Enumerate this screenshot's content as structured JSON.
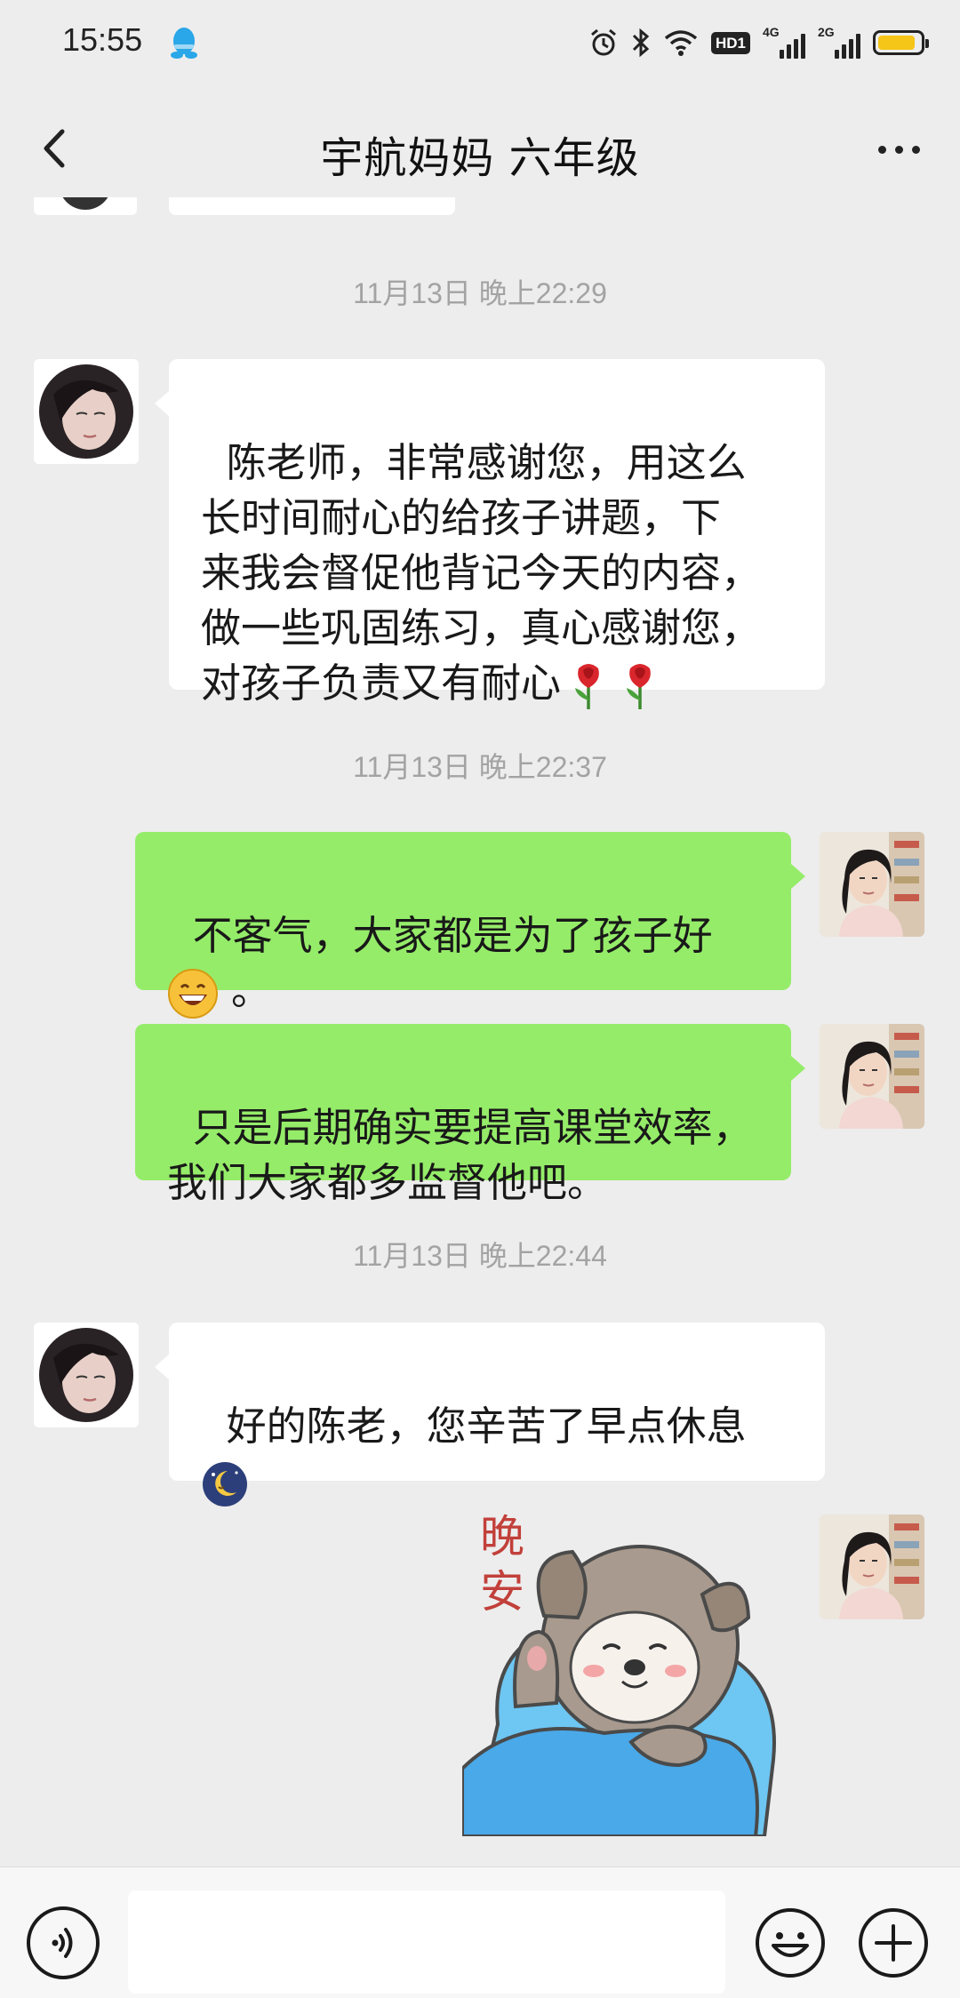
{
  "status_bar": {
    "time": "15:55",
    "hd_badge": "HD1",
    "network_1": "4G",
    "network_2": "2G",
    "battery_level": 0.9
  },
  "header": {
    "title": "宇航妈妈  六年级"
  },
  "colors": {
    "background": "#ededed",
    "bubble_incoming": "#ffffff",
    "bubble_outgoing": "#95ec69",
    "timestamp": "#a3a3a3",
    "battery_fill": "#f5c518"
  },
  "messages": [
    {
      "type": "timestamp",
      "text": "11月13日 晚上22:29"
    },
    {
      "type": "incoming",
      "text": "陈老师，非常感谢您，用这么\n长时间耐心的给孩子讲题，下\n来我会督促他背记今天的内容，\n做一些巩固练习，真心感谢您，\n对孩子负责又有耐心",
      "emojis": [
        "rose-icon",
        "rose-icon"
      ]
    },
    {
      "type": "timestamp",
      "text": "11月13日 晚上22:37"
    },
    {
      "type": "outgoing",
      "text": "不客气，大家都是为了孩子好",
      "emojis": [
        "grin-icon"
      ],
      "suffix": "。"
    },
    {
      "type": "outgoing",
      "text": "只是后期确实要提高课堂效率，\n我们大家都多监督他吧。"
    },
    {
      "type": "timestamp",
      "text": "11月13日 晚上22:44"
    },
    {
      "type": "incoming",
      "text": "好的陈老，您辛苦了早点休息",
      "emojis": [
        "sleepy-moon-icon"
      ]
    },
    {
      "type": "outgoing-sticker",
      "sticker_text": "晚\n安",
      "sticker": "sleeping-dog-sticker"
    }
  ],
  "input_bar": {
    "placeholder": "",
    "icons": [
      "voice-icon",
      "emoji-face-icon",
      "plus-icon"
    ]
  }
}
